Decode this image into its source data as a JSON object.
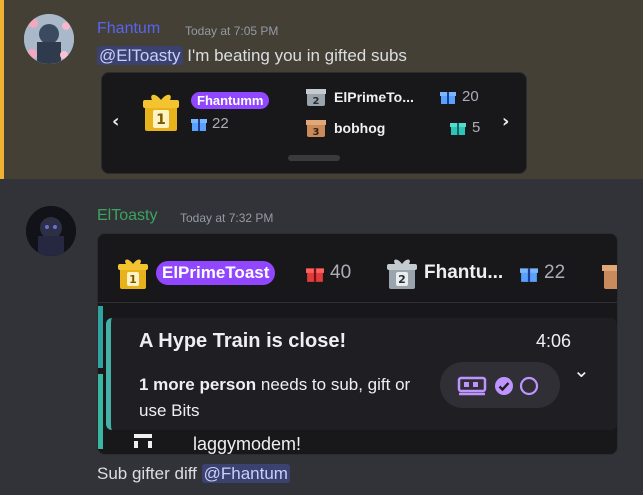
{
  "messages": [
    {
      "author": "Fhantum",
      "author_color": "#5865f2",
      "timestamp": "Today at 7:05 PM",
      "mention": "@ElToasty",
      "text": " I'm beating you in gifted subs",
      "embed": {
        "top_user": {
          "name": "Fhantumm",
          "gift_count": "22"
        },
        "ranks": [
          {
            "name": "ElPrimeTo...",
            "gift_count": "20"
          },
          {
            "name": "bobhog",
            "gift_count": "5"
          }
        ]
      }
    },
    {
      "author": "ElToasty",
      "author_color": "#3ba55d",
      "timestamp": "Today at 7:32 PM",
      "embed": {
        "leaderboard": [
          {
            "name": "ElPrimeToast",
            "gift_count": "40"
          },
          {
            "name": "Fhantu...",
            "gift_count": "22"
          }
        ],
        "hype_train": {
          "title": "A Hype Train is close!",
          "timer": "4:06",
          "body_bold": "1 more person",
          "body_rest": " needs to sub, gift or use Bits"
        },
        "tail_text": "laggymodem!"
      },
      "text": "Sub gifter diff ",
      "mention": "@Fhantum"
    }
  ],
  "colors": {
    "twitch_purple": "#9147ff",
    "mention_bg": "#3c4270",
    "highlight_bar": "#f0b232"
  },
  "icons": {
    "gift": "gift-icon",
    "rank_badge": "rank-badge-icon",
    "train": "train-icon",
    "check": "check-circle-icon"
  }
}
